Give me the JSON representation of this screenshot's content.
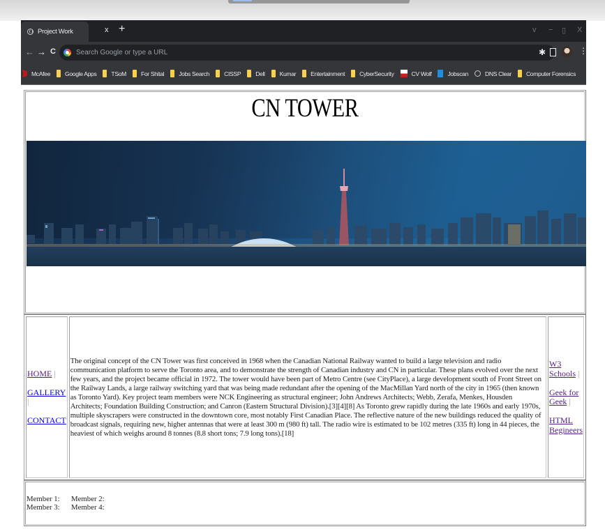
{
  "browser": {
    "tab_title": "Project Work",
    "tab_close": "x",
    "new_tab": "+",
    "window_controls": {
      "dropdown": "v",
      "minimize": "−",
      "maximize": "▯",
      "close": "X"
    },
    "nav": {
      "back": "←",
      "forward": "→",
      "reload": "C"
    },
    "omnibox_placeholder": "Search Google or type a URL",
    "toolbar_icons": [
      "extensions-icon",
      "sidebar-icon",
      "profile-avatar",
      "menu-icon"
    ],
    "bookmarks": [
      {
        "label": "McAfee",
        "icon": "mcafee-icon"
      },
      {
        "label": "Google Apps",
        "icon": "folder-icon"
      },
      {
        "label": "TSoM",
        "icon": "folder-icon"
      },
      {
        "label": "For Shital",
        "icon": "folder-icon"
      },
      {
        "label": "Jobs Search",
        "icon": "folder-icon"
      },
      {
        "label": "CISSP",
        "icon": "folder-icon"
      },
      {
        "label": "Dell",
        "icon": "folder-icon"
      },
      {
        "label": "Kumar",
        "icon": "folder-icon"
      },
      {
        "label": "Entertainment",
        "icon": "folder-icon"
      },
      {
        "label": "CyberSecurity",
        "icon": "folder-icon"
      },
      {
        "label": "CV Wolf",
        "icon": "cvwolf-icon"
      },
      {
        "label": "Jobscan",
        "icon": "jobscan-icon"
      },
      {
        "label": "DNS Clear",
        "icon": "globe-icon"
      },
      {
        "label": "Computer Forensics",
        "icon": "folder-icon"
      }
    ]
  },
  "page": {
    "title": "CN TOWER",
    "banner_alt": "Toronto skyline at dusk with the CN Tower",
    "left_nav": [
      {
        "label": "HOME",
        "sep": "|",
        "visited": true
      },
      {
        "label": "GALLERY",
        "sep": "|",
        "visited": false
      },
      {
        "label": "CONTACT",
        "sep": "",
        "visited": false
      }
    ],
    "body_text": "The original concept of the CN Tower was first conceived in 1968 when the Canadian National Railway wanted to build a large television and radio communication platform to serve the Toronto area, and to demonstrate the strength of Canadian industry and CN in particular. These plans evolved over the next few years, and the project became official in 1972. The tower would have been part of Metro Centre (see CityPlace), a large development south of Front Street on the Railway Lands, a large railway switching yard that was being made redundant after the opening of the MacMillan Yard north of the city in 1965 (then known as Toronto Yard). Key project team members were NCK Engineering as structural engineer; John Andrews Architects; Webb, Zerafa, Menkes, Housden Architects; Foundation Building Construction; and Canron (Eastern Structural Division).[3][4][8] As Toronto grew rapidly during the late 1960s and early 1970s, multiple skyscrapers were constructed in the downtown core, most notably First Canadian Place. The reflective nature of the new buildings reduced the quality of broadcast signals, requiring new, higher antennas that were at least 300 m (980 ft) tall. The radio wire is estimated to be 102 metres (335 ft) long in 44 pieces, the heaviest of which weighs around 8 tonnes (8.8 short tons; 7.9 long tons).[18]",
    "right_nav": [
      {
        "label": "W3 Schools",
        "sep": "|"
      },
      {
        "label": "Geek for Geek",
        "sep": "|"
      },
      {
        "label": "HTML Begineers",
        "sep": ""
      }
    ],
    "members": [
      [
        "Member 1:",
        "Member 2:"
      ],
      [
        "Member 3:",
        "Member 4:"
      ]
    ]
  },
  "colors": {
    "link_visited": "#551a8b",
    "link_unvisited": "#0000ee",
    "chrome_dark": "#35363a",
    "tabstrip": "#202124"
  }
}
